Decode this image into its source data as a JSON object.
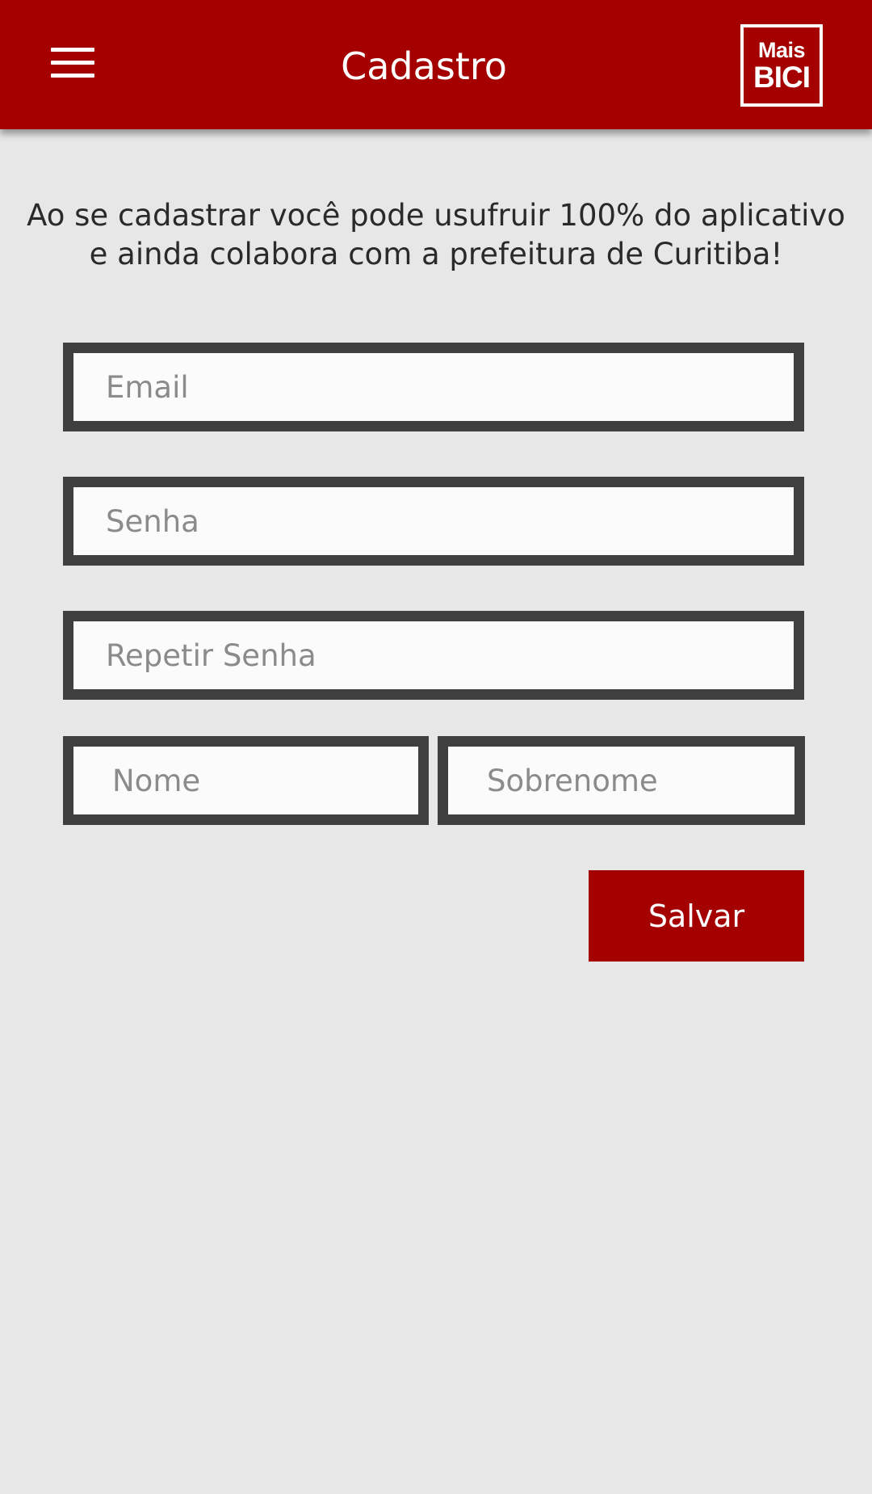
{
  "appbar": {
    "title": "Cadastro",
    "menu_icon": "hamburger-menu-icon",
    "logo": {
      "line1": "Mais",
      "line2": "BICI"
    },
    "color": "#a50000"
  },
  "intro_text": "Ao se cadastrar você pode usufruir 100% do aplicativo e ainda colabora com a prefeitura de Curitiba!",
  "form": {
    "email": {
      "placeholder": "Email",
      "value": ""
    },
    "senha": {
      "placeholder": "Senha",
      "value": ""
    },
    "repetir_senha": {
      "placeholder": "Repetir Senha",
      "value": ""
    },
    "nome": {
      "placeholder": "Nome",
      "value": ""
    },
    "sobrenome": {
      "placeholder": "Sobrenome",
      "value": ""
    }
  },
  "save_button": {
    "label": "Salvar",
    "color": "#a50000"
  },
  "background_color": "#e7e7e7"
}
